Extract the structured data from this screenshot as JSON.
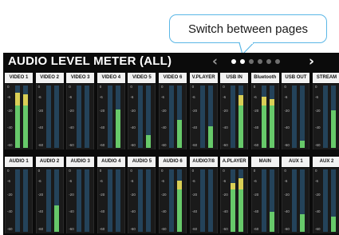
{
  "callout": {
    "text": "Switch between pages"
  },
  "screen": {
    "title": "AUDIO LEVEL METER (ALL)",
    "nav": {
      "prev": "‹",
      "next": "›",
      "page_count": 6,
      "current_page": 2
    },
    "scale_marks": [
      "0",
      "-6",
      "-20",
      "-40",
      "-60"
    ],
    "colors": {
      "meter_bg": "#24435a",
      "green": "#67c96a",
      "yellow": "#d9cf56",
      "label_bg": "#f2f2f2"
    },
    "row1": [
      {
        "label": "VIDEO 1",
        "levels": [
          0.88,
          0.86
        ]
      },
      {
        "label": "VIDEO 2",
        "levels": [
          0.0,
          0.0
        ]
      },
      {
        "label": "VIDEO 3",
        "levels": [
          0.0,
          0.0
        ]
      },
      {
        "label": "VIDEO 4",
        "levels": [
          0.0,
          0.62
        ]
      },
      {
        "label": "VIDEO 5",
        "levels": [
          0.0,
          0.2
        ]
      },
      {
        "label": "VIDEO 6",
        "levels": [
          0.0,
          0.45
        ]
      },
      {
        "label": "V.PLAYER",
        "levels": [
          0.0,
          0.34
        ]
      },
      {
        "label": "USB IN",
        "levels": [
          0.0,
          0.85
        ]
      },
      {
        "label": "Bluetooth",
        "levels": [
          0.82,
          0.78
        ]
      },
      {
        "label": "USB OUT",
        "levels": [
          0.0,
          0.12
        ]
      },
      {
        "label": "STREAM",
        "levels": [
          0.0,
          0.6
        ]
      }
    ],
    "row2": [
      {
        "label": "AUDIO 1",
        "levels": [
          0.0,
          0.0
        ]
      },
      {
        "label": "AUDIO 2",
        "levels": [
          0.0,
          0.42
        ]
      },
      {
        "label": "AUDIO 3",
        "levels": [
          0.0,
          0.0
        ]
      },
      {
        "label": "AUDIO 4",
        "levels": [
          0.0,
          0.0
        ]
      },
      {
        "label": "AUDIO 5",
        "levels": [
          0.0,
          0.0
        ]
      },
      {
        "label": "AUDIO 6",
        "levels": [
          0.0,
          0.82
        ]
      },
      {
        "label": "AUDIO7/8",
        "levels": [
          0.0,
          0.0
        ]
      },
      {
        "label": "A.PLAYER",
        "levels": [
          0.78,
          0.86
        ]
      },
      {
        "label": "MAIN",
        "levels": [
          0.0,
          0.32
        ]
      },
      {
        "label": "AUX 1",
        "levels": [
          0.0,
          0.28
        ]
      },
      {
        "label": "AUX 2",
        "levels": [
          0.0,
          0.25
        ]
      }
    ]
  }
}
